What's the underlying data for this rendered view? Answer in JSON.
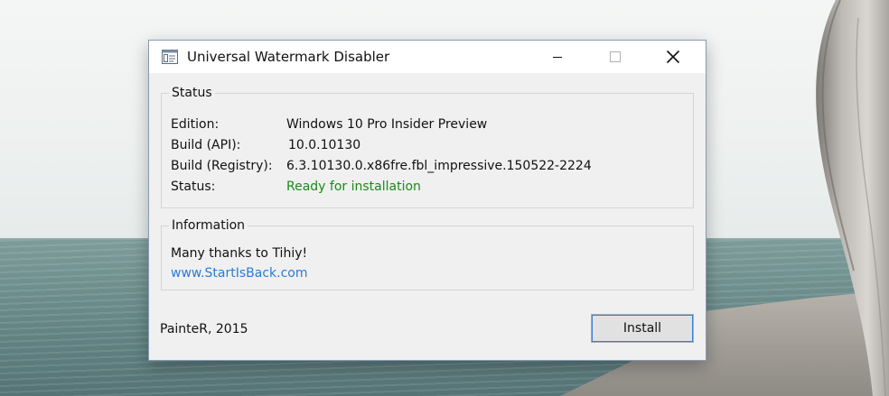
{
  "window": {
    "title": "Universal Watermark Disabler",
    "app_icon": "window-app-icon",
    "controls": {
      "minimize": "minimize-icon",
      "maximize": "maximize-icon",
      "close": "close-icon"
    }
  },
  "status_group": {
    "title": "Status",
    "rows": [
      {
        "label": "Edition:",
        "value": "Windows 10 Pro Insider Preview"
      },
      {
        "label": "Build (API):",
        "value": "10.0.10130"
      },
      {
        "label": "Build (Registry):",
        "value": "6.3.10130.0.x86fre.fbl_impressive.150522-2224"
      },
      {
        "label": "Status:",
        "value": "Ready for installation"
      }
    ],
    "status_color": "#1a8b1a"
  },
  "info_group": {
    "title": "Information",
    "thanks": "Many thanks to Tihiy!",
    "link": "www.StartIsBack.com",
    "link_color": "#2a7bd4"
  },
  "footer": {
    "credit": "PainteR, 2015",
    "install_label": "Install"
  }
}
